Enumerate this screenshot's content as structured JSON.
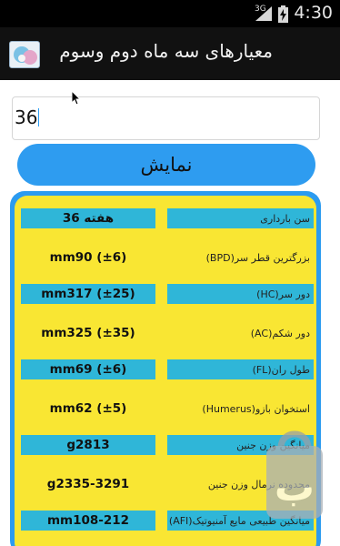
{
  "status_bar": {
    "network": "3G",
    "time": "4:30"
  },
  "action_bar": {
    "title": "معیارهای سه ماه دوم وسوم",
    "icon": "app-logo-icon"
  },
  "input": {
    "value": "36"
  },
  "show_button": {
    "label": "نمایش"
  },
  "results": [
    {
      "label": "سن بارداری",
      "value": "36 هفته"
    },
    {
      "label": "بزرگترین قطر سر(BPD)",
      "value": "mm90 (±6)"
    },
    {
      "label": "دور سر(HC)",
      "value": "mm317 (±25)"
    },
    {
      "label": "دور شکم(AC)",
      "value": "mm325 (±35)"
    },
    {
      "label": "طول ران(FL)",
      "value": "mm69 (±6)"
    },
    {
      "label": "استخوان بازو(Humerus)",
      "value": "mm62 (±5)"
    },
    {
      "label": "میانگین وزن جنین",
      "value": "g2813"
    },
    {
      "label": "محدوده نرمال وزن جنین",
      "value": "g2335-3291"
    },
    {
      "label": "میانگین طبیعی مایع آمنیوتیک(AFI)",
      "value": "mm108-212"
    }
  ],
  "colors": {
    "accent_blue": "#2e9cf0",
    "panel_yellow": "#f9e633",
    "band_cyan": "#2fb6d8",
    "action_bar": "#111111"
  }
}
